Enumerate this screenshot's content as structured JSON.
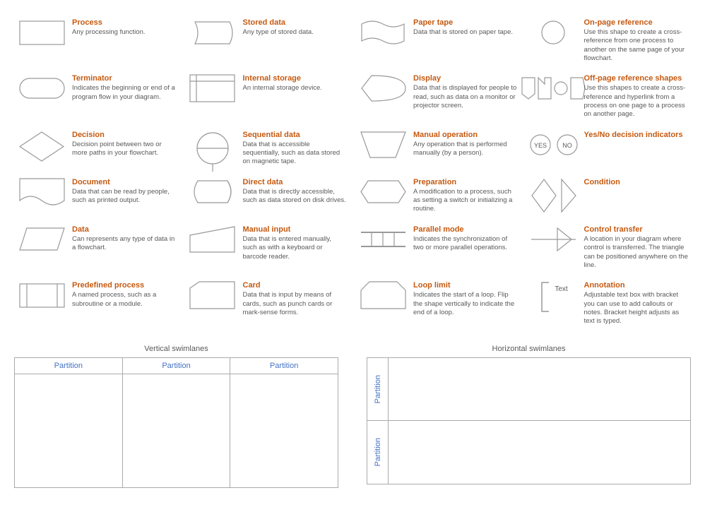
{
  "shapes": {
    "col1": [
      {
        "id": "process",
        "title": "Process",
        "desc": "Any processing function.",
        "shape": "rectangle"
      },
      {
        "id": "terminator",
        "title": "Terminator",
        "desc": "Indicates the beginning or end of a program flow in your diagram.",
        "shape": "stadium"
      },
      {
        "id": "decision",
        "title": "Decision",
        "desc": "Decision point between two or more paths in your flowchart.",
        "shape": "diamond"
      },
      {
        "id": "document",
        "title": "Document",
        "desc": "Data that can be read by people, such as printed output.",
        "shape": "document"
      },
      {
        "id": "data",
        "title": "Data",
        "desc": "Can represents any type of data in a flowchart.",
        "shape": "parallelogram"
      },
      {
        "id": "predefined-process",
        "title": "Predefined process",
        "desc": "A named process, such as a subroutine or a module.",
        "shape": "predefined"
      }
    ],
    "col2": [
      {
        "id": "stored-data",
        "title": "Stored data",
        "desc": "Any type of stored data.",
        "shape": "stored-data"
      },
      {
        "id": "internal-storage",
        "title": "Internal storage",
        "desc": "An internal storage device.",
        "shape": "internal-storage"
      },
      {
        "id": "sequential-data",
        "title": "Sequential data",
        "desc": "Data that is accessible sequentially, such as data stored on magnetic tape.",
        "shape": "sequential-data"
      },
      {
        "id": "direct-data",
        "title": "Direct data",
        "desc": "Data that is directly accessible, such as data stored on disk drives.",
        "shape": "direct-data"
      },
      {
        "id": "manual-input",
        "title": "Manual input",
        "desc": "Data that is entered manually, such as with a keyboard or barcode reader.",
        "shape": "manual-input"
      },
      {
        "id": "card",
        "title": "Card",
        "desc": "Data that is input by means of cards, such as punch cards or mark-sense forms.",
        "shape": "card"
      }
    ],
    "col3": [
      {
        "id": "paper-tape",
        "title": "Paper tape",
        "desc": "Data that is stored on paper tape.",
        "shape": "paper-tape"
      },
      {
        "id": "display",
        "title": "Display",
        "desc": "Data that is displayed for people to read, such as data on a monitor or projector screen.",
        "shape": "display"
      },
      {
        "id": "manual-operation",
        "title": "Manual operation",
        "desc": "Any operation that is performed manually (by a person).",
        "shape": "manual-operation"
      },
      {
        "id": "preparation",
        "title": "Preparation",
        "desc": "A modification to a process, such as setting a switch or initializing a routine.",
        "shape": "preparation"
      },
      {
        "id": "parallel-mode",
        "title": "Parallel mode",
        "desc": "Indicates the synchronization of two or more parallel operations.",
        "shape": "parallel-mode"
      },
      {
        "id": "loop-limit",
        "title": "Loop limit",
        "desc": "Indicates the start of a loop. Flip the shape vertically to indicate the end of a loop.",
        "shape": "loop-limit"
      }
    ],
    "col4": [
      {
        "id": "on-page-reference",
        "title": "On-page reference",
        "desc": "Use this shape to create a cross-reference from one process to another on the same page of your flowchart.",
        "shape": "circle"
      },
      {
        "id": "off-page-reference",
        "title": "Off-page reference shapes",
        "desc": "Use this shapes to create a cross-reference and hyperlink from a process on one page to a process on another page.",
        "shape": "off-page"
      },
      {
        "id": "yes-no",
        "title": "Yes/No decision indicators",
        "desc": "",
        "shape": "yes-no"
      },
      {
        "id": "condition",
        "title": "Condition",
        "desc": "",
        "shape": "condition"
      },
      {
        "id": "control-transfer",
        "title": "Control transfer",
        "desc": "A location in your diagram where control is transferred. The triangle can be positioned anywhere on the line.",
        "shape": "control-transfer"
      },
      {
        "id": "annotation",
        "title": "Annotation",
        "desc": "Adjustable text box with bracket you can use to add callouts or notes. Bracket height adjusts as text is typed.",
        "shape": "annotation"
      }
    ]
  },
  "swimlanes": {
    "vertical": {
      "title": "Vertical swimlanes",
      "partitions": [
        "Partition",
        "Partition",
        "Partition"
      ]
    },
    "horizontal": {
      "title": "Horizontal swimlanes",
      "partitions": [
        "Partition",
        "Partition"
      ]
    }
  }
}
